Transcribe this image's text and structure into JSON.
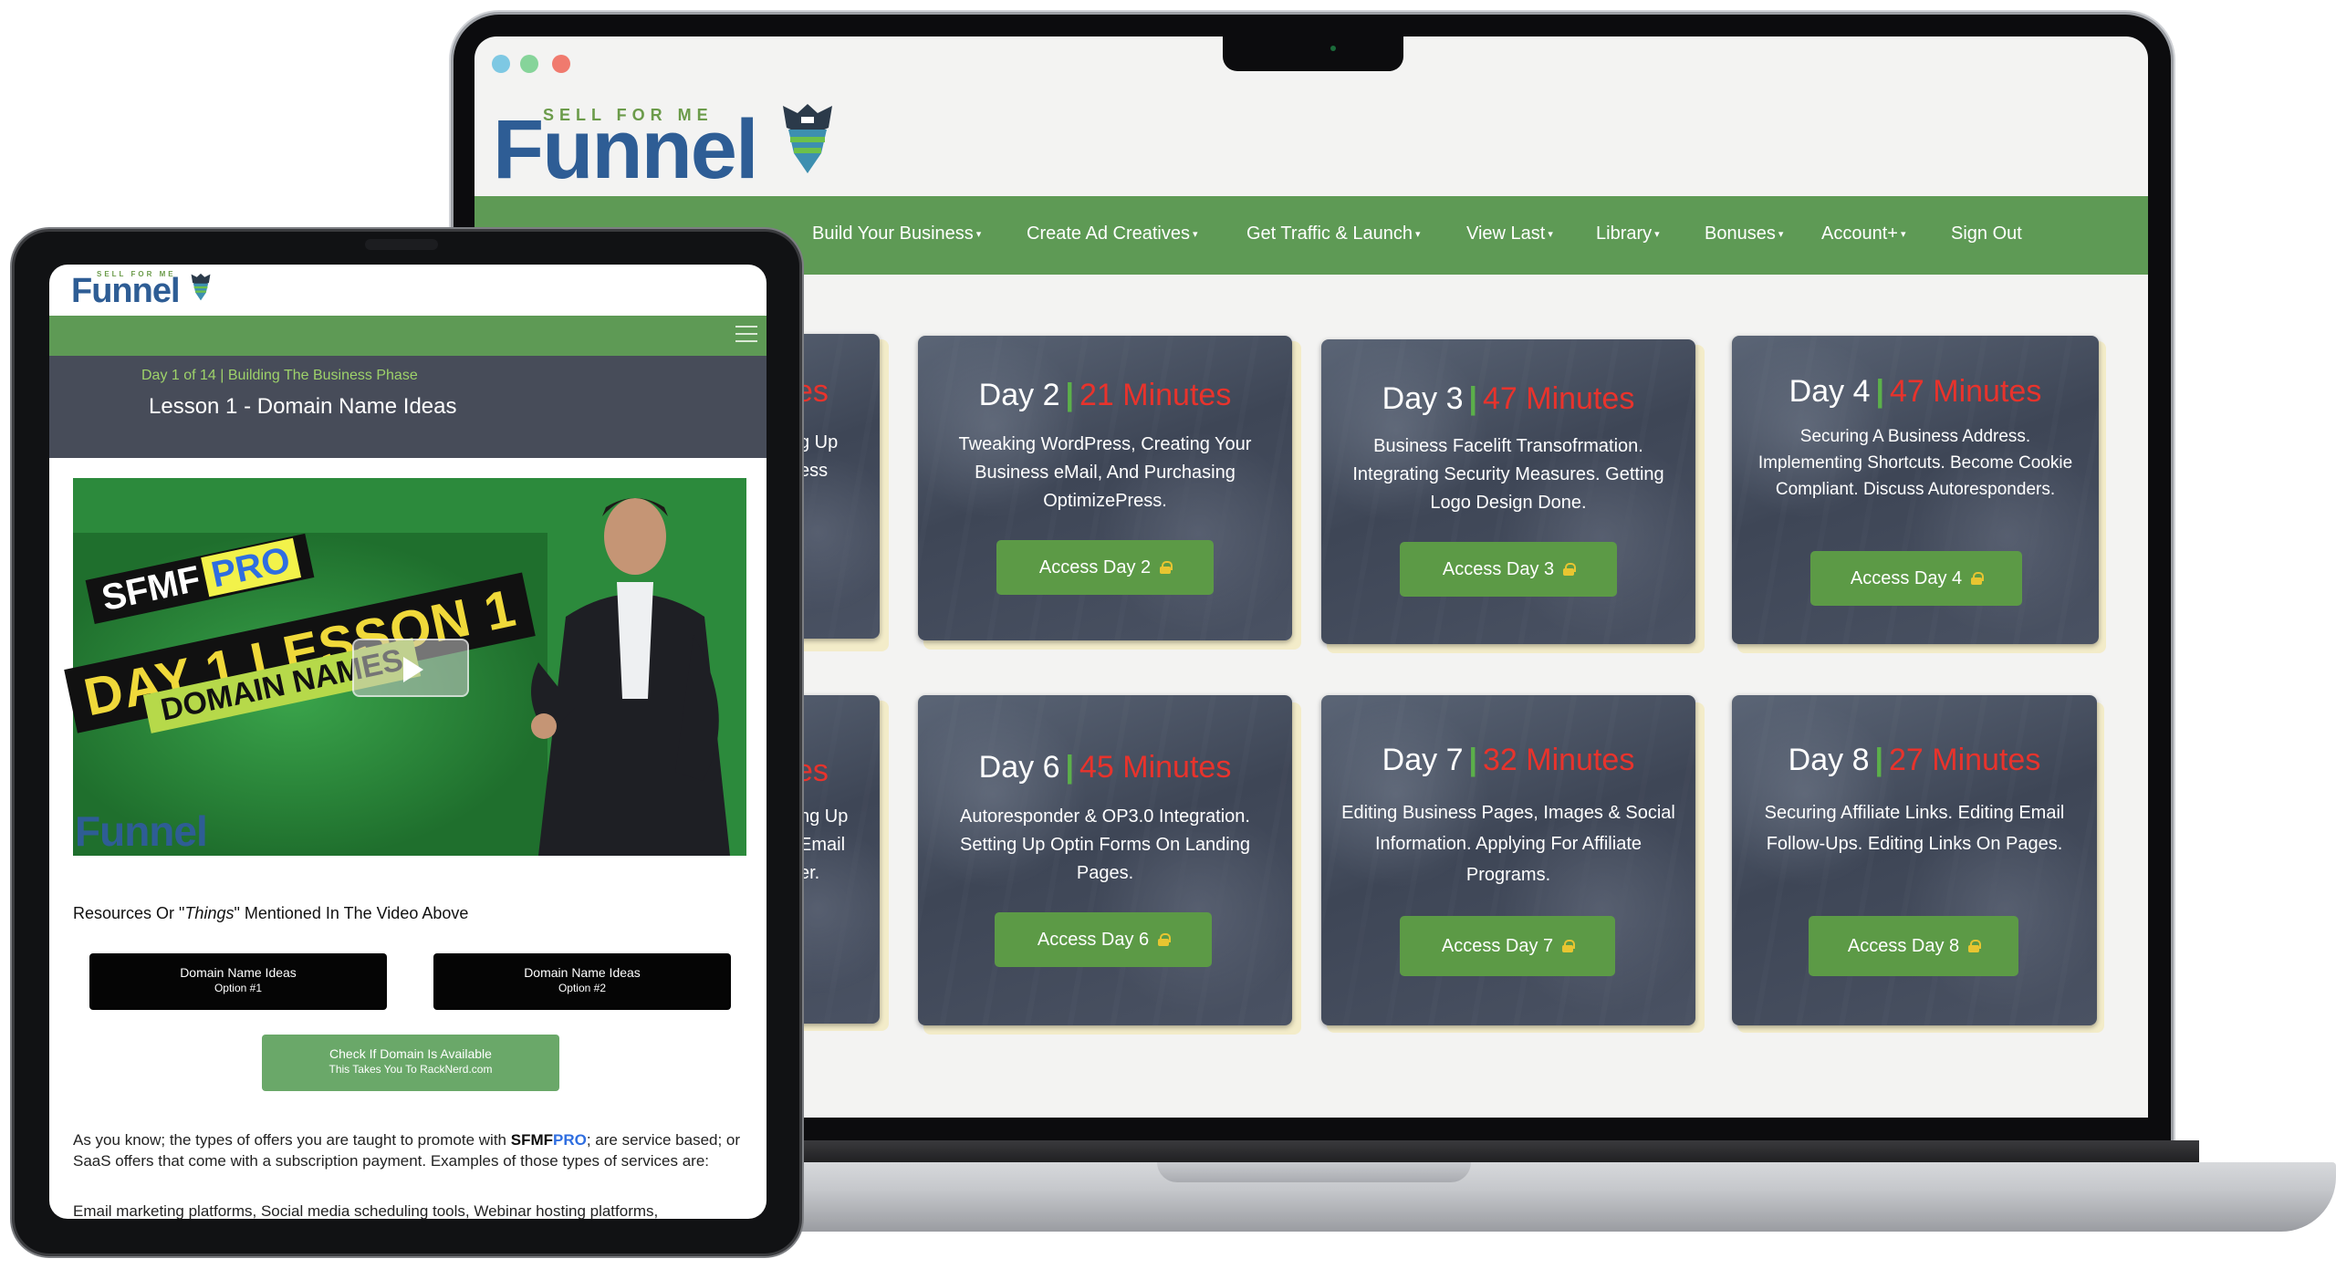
{
  "desktop": {
    "logo": {
      "small_text": "SELL FOR ME",
      "main_text": "Funnel"
    },
    "nav": [
      {
        "label": "Build Your Business"
      },
      {
        "label": "Create Ad Creatives"
      },
      {
        "label": "Get Traffic & Launch"
      },
      {
        "label": "View Last"
      },
      {
        "label": "Library"
      },
      {
        "label": "Bonuses"
      },
      {
        "label": "Account+"
      },
      {
        "label": "Sign Out"
      }
    ],
    "partial_cards": [
      {
        "title_fragment": "es",
        "desc_lines": [
          "g Up",
          "ess"
        ]
      },
      {
        "title_fragment": "es",
        "desc_lines": [
          "ng Up",
          "Email",
          "er."
        ]
      }
    ],
    "cards": [
      {
        "day": "Day 2",
        "minutes": "21 Minutes",
        "description": "Tweaking WordPress, Creating Your Business eMail, And Purchasing OptimizePress.",
        "button": "Access Day 2"
      },
      {
        "day": "Day 3",
        "minutes": "47 Minutes",
        "description": "Business Facelift Transofrmation. Integrating Security Measures. Getting Logo Design Done.",
        "button": "Access Day 3"
      },
      {
        "day": "Day 4",
        "minutes": "47 Minutes",
        "description": "Securing A Business Address. Implementing Shortcuts. Become Cookie Compliant. Discuss Autoresponders.",
        "button": "Access Day 4"
      },
      {
        "day": "Day 6",
        "minutes": "45 Minutes",
        "description": "Autoresponder & OP3.0 Integration. Setting Up Optin Forms On Landing Pages.",
        "button": "Access Day 6"
      },
      {
        "day": "Day 7",
        "minutes": "32 Minutes",
        "description": "Editing Business Pages, Images & Social Information. Applying For Affiliate Programs.",
        "button": "Access Day 7"
      },
      {
        "day": "Day 8",
        "minutes": "27 Minutes",
        "description": "Securing Affiliate Links. Editing Email Follow-Ups. Editing Links On Pages.",
        "button": "Access Day 8"
      }
    ],
    "colors": {
      "nav_green": "#5e9a55",
      "minutes_red": "#e8332c",
      "bar_green": "#5bb04a",
      "button_green": "#5c9a46",
      "logo_blue": "#2e5d95"
    }
  },
  "tablet": {
    "logo": {
      "small_text": "SELL FOR ME",
      "main_text": "Funnel"
    },
    "breadcrumb": "Day 1 of 14 | Building The Business Phase",
    "lesson_title": "Lesson 1 - Domain Name Ideas",
    "video": {
      "line1": "SFMF",
      "line1_highlight": "PRO",
      "line2": "DAY 1 LESSON 1",
      "line3": "DOMAIN NAMES",
      "watermark": "Funnel"
    },
    "resources_prefix": "Resources Or \"",
    "resources_italic": "Things",
    "resources_suffix": "\" Mentioned In The Video Above",
    "buttons": [
      {
        "line1": "Domain Name Ideas",
        "line2": "Option #1"
      },
      {
        "line1": "Domain Name Ideas",
        "line2": "Option #2"
      }
    ],
    "check_button": {
      "line1": "Check If Domain Is Available",
      "line2": "This Takes You To RackNerd.com"
    },
    "body_prefix": "As you know; the types of offers you are taught to promote with ",
    "body_brand": "SFMF",
    "body_brand_pro": "PRO",
    "body_suffix": "; are service based; or SaaS offers that come with a subscription payment.  Examples of those types of services are:",
    "body_line2": "Email marketing platforms, Social media scheduling tools, Webinar hosting platforms,"
  }
}
